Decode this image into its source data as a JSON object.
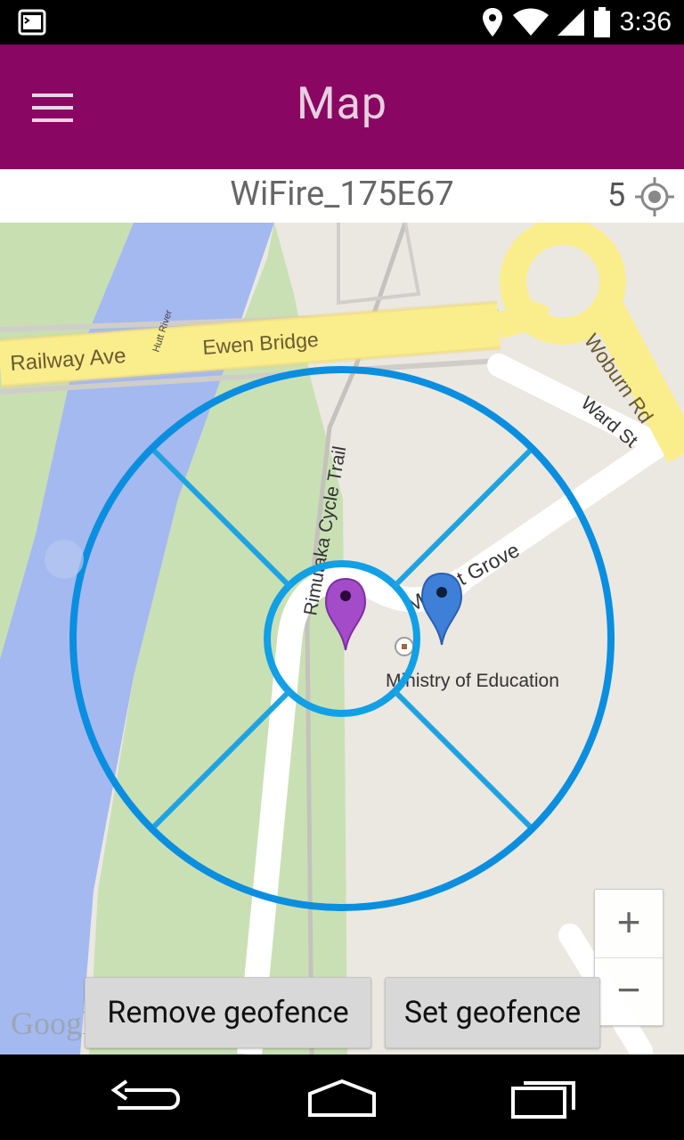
{
  "status_bar": {
    "time": "3:36",
    "icons": [
      "terminal-icon",
      "location-icon",
      "wifi-icon",
      "signal-icon",
      "battery-icon"
    ]
  },
  "action_bar": {
    "title": "Map",
    "menu_icon": "hamburger-menu-icon",
    "color": "#8a0663"
  },
  "device": {
    "name": "WiFire_175E67",
    "count": "5",
    "locate_icon": "locate-icon"
  },
  "map": {
    "streets": {
      "railway_ave": "Railway Ave",
      "ewen_bridge": "Ewen Bridge",
      "hutt_river": "Hutt River",
      "woburn_rd": "Woburn Rd",
      "ward_st": "Ward St",
      "rimutaka_trail": "Rimutaka Cycle Trail",
      "market_grove": "Market Grove"
    },
    "poi": "Ministry of Education",
    "attribution": "Google",
    "geofence_color": "#0a8ee0",
    "markers": [
      "purple-marker",
      "blue-marker"
    ]
  },
  "zoom": {
    "in": "+",
    "out": "−"
  },
  "buttons": {
    "remove": "Remove geofence",
    "set": "Set geofence"
  },
  "nav_bar": {
    "icons": [
      "back-icon",
      "home-icon",
      "recents-icon"
    ]
  }
}
